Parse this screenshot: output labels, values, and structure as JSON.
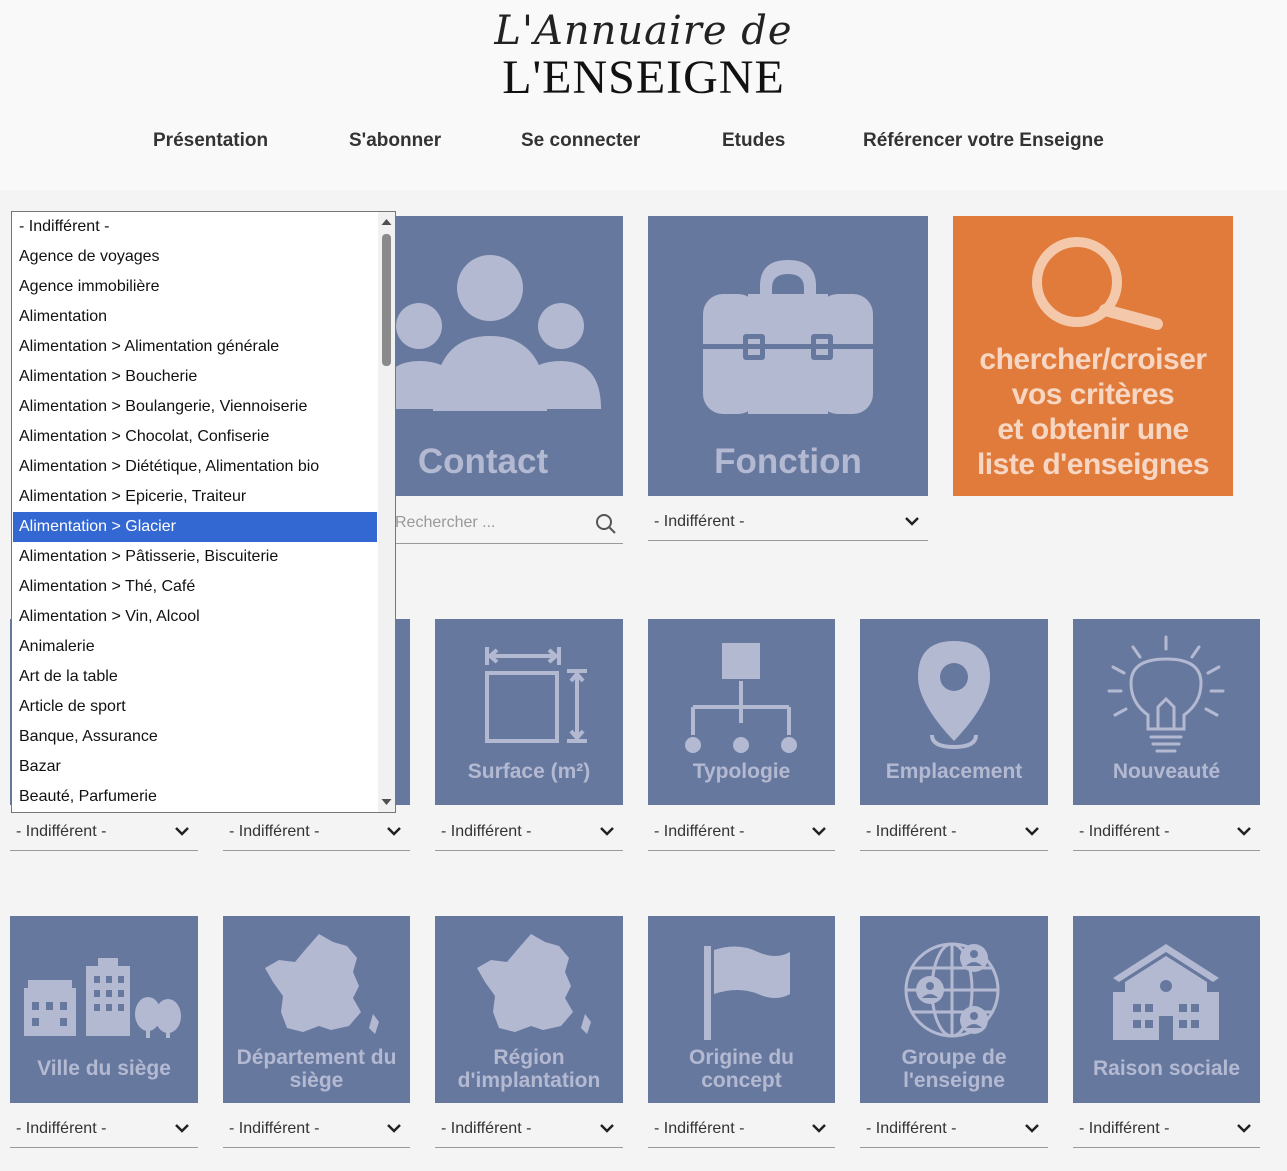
{
  "logo": {
    "script": "L'Annuaire de",
    "main": "L'ENSEIGNE"
  },
  "nav": [
    "Présentation",
    "S'abonner",
    "Se connecter",
    "Etudes",
    "Référencer votre Enseigne"
  ],
  "top_tiles": {
    "contact": {
      "label": "Contact",
      "search_placeholder": "Rechercher ..."
    },
    "fonction": {
      "label": "Fonction",
      "value": "- Indifférent -"
    },
    "search_cta": {
      "lines": [
        "chercher/croiser",
        "vos critères",
        "et obtenir une",
        "liste d'enseignes"
      ]
    }
  },
  "row2": [
    {
      "label": "",
      "value": "- Indifférent -",
      "icon": "hidden-tile"
    },
    {
      "label": "",
      "value": "- Indifférent -",
      "icon": "hidden-tile"
    },
    {
      "label": "Surface (m²)",
      "value": "- Indifférent -",
      "icon": "surface-icon"
    },
    {
      "label": "Typologie",
      "value": "- Indifférent -",
      "icon": "hierarchy-icon"
    },
    {
      "label": "Emplacement",
      "value": "- Indifférent -",
      "icon": "map-pin-icon"
    },
    {
      "label": "Nouveauté",
      "value": "- Indifférent -",
      "icon": "lightbulb-icon"
    }
  ],
  "row3": [
    {
      "label": "Ville du siège",
      "value": "- Indifférent -",
      "icon": "city-icon"
    },
    {
      "label": "Département du siège",
      "value": "- Indifférent -",
      "icon": "france-map-icon"
    },
    {
      "label": "Région d'implantation",
      "value": "- Indifférent -",
      "icon": "france-map-icon"
    },
    {
      "label": "Origine du concept",
      "value": "- Indifférent -",
      "icon": "flag-icon"
    },
    {
      "label": "Groupe de l'enseigne",
      "value": "- Indifférent -",
      "icon": "globe-users-icon"
    },
    {
      "label": "Raison sociale",
      "value": "- Indifférent -",
      "icon": "building-icon"
    }
  ],
  "listbox": {
    "selected_index": 10,
    "options": [
      "- Indifférent -",
      "Agence de voyages",
      "Agence immobilière",
      "Alimentation",
      "Alimentation > Alimentation générale",
      "Alimentation > Boucherie",
      "Alimentation > Boulangerie, Viennoiserie",
      "Alimentation > Chocolat, Confiserie",
      "Alimentation > Diététique, Alimentation bio",
      "Alimentation > Epicerie, Traiteur",
      "Alimentation > Glacier",
      "Alimentation > Pâtisserie, Biscuiterie",
      "Alimentation > Thé, Café",
      "Alimentation > Vin, Alcool",
      "Animalerie",
      "Art de la table",
      "Article de sport",
      "Banque, Assurance",
      "Bazar",
      "Beauté, Parfumerie"
    ]
  },
  "colors": {
    "tile": "#67789f",
    "tile_text": "#b4b9d2",
    "cta": "#e07b3b",
    "selection": "#3367d1"
  }
}
